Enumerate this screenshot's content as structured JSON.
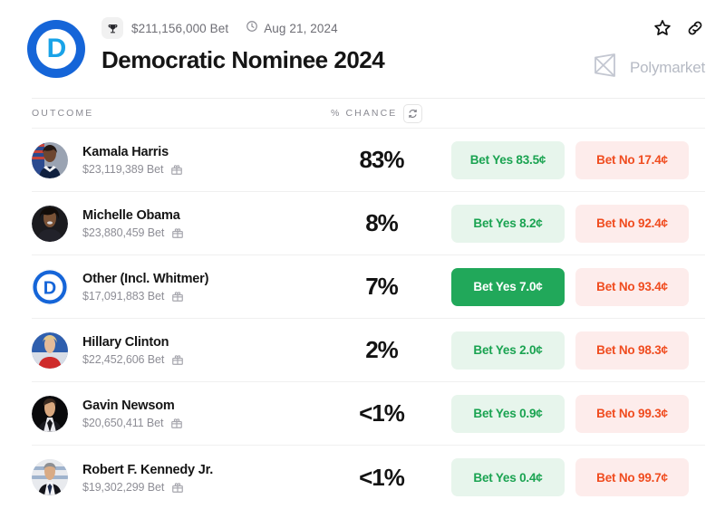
{
  "header": {
    "logo_icon": "democratic-party-d-logo",
    "logo_letter": "D",
    "trophy_icon": "trophy-icon",
    "volume": "$211,156,000 Bet",
    "clock_icon": "clock-icon",
    "date": "Aug 21, 2024",
    "title": "Democratic Nominee 2024",
    "star_icon": "star-icon",
    "link_icon": "link-icon",
    "brand_icon": "polymarket-logo",
    "brand_name": "Polymarket"
  },
  "table": {
    "col_outcome": "OUTCOME",
    "col_chance": "% CHANCE",
    "refresh_icon": "refresh-icon",
    "gift_icon": "gift-icon",
    "rows": [
      {
        "name": "Kamala Harris",
        "bet": "$23,119,389 Bet",
        "chance": "83%",
        "yes_label": "Bet Yes 83.5¢",
        "no_label": "Bet No 17.4¢",
        "yes_active": false,
        "avatar": "kamala-harris-avatar"
      },
      {
        "name": "Michelle Obama",
        "bet": "$23,880,459 Bet",
        "chance": "8%",
        "yes_label": "Bet Yes 8.2¢",
        "no_label": "Bet No 92.4¢",
        "yes_active": false,
        "avatar": "michelle-obama-avatar"
      },
      {
        "name": "Other (Incl. Whitmer)",
        "bet": "$17,091,883 Bet",
        "chance": "7%",
        "yes_label": "Bet Yes 7.0¢",
        "no_label": "Bet No 93.4¢",
        "yes_active": true,
        "avatar": "democratic-party-d-logo"
      },
      {
        "name": "Hillary Clinton",
        "bet": "$22,452,606 Bet",
        "chance": "2%",
        "yes_label": "Bet Yes 2.0¢",
        "no_label": "Bet No 98.3¢",
        "yes_active": false,
        "avatar": "hillary-clinton-avatar"
      },
      {
        "name": "Gavin Newsom",
        "bet": "$20,650,411 Bet",
        "chance": "<1%",
        "yes_label": "Bet Yes 0.9¢",
        "no_label": "Bet No 99.3¢",
        "yes_active": false,
        "avatar": "gavin-newsom-avatar"
      },
      {
        "name": "Robert F. Kennedy Jr.",
        "bet": "$19,302,299 Bet",
        "chance": "<1%",
        "yes_label": "Bet Yes 0.4¢",
        "no_label": "Bet No 99.7¢",
        "yes_active": false,
        "avatar": "robert-f-kennedy-jr-avatar"
      }
    ]
  },
  "colors": {
    "yes_text": "#1aa351",
    "yes_bg": "#e7f5ec",
    "yes_active_bg": "#21a85a",
    "no_text": "#f04c1f",
    "no_bg": "#fdeceb",
    "dem_blue": "#1565d8",
    "dem_light_blue": "#19a3e8"
  }
}
